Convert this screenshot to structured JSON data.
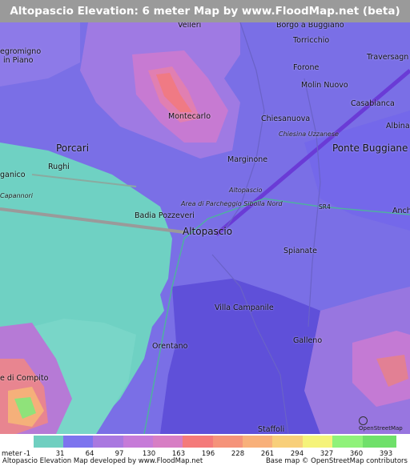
{
  "title": "Altopascio Elevation: 6 meter Map by www.FloodMap.net (beta)",
  "map": {
    "labels": {
      "vellori": "Velleri",
      "borgo": "Borgo a Buggiano",
      "torricchio": "Torricchio",
      "negromigno": "egromigno",
      "inpiano": "in Piano",
      "traversagna": "Traversagn",
      "forone": "Forone",
      "molin_nuovo": "Molin Nuovo",
      "montecarlo": "Montecarlo",
      "casabianca": "Casabianca",
      "chiesanuova": "Chiesanuova",
      "albinatico": "Albinat",
      "chiesina": "Chiesina Uzzanese",
      "porcari": "Porcari",
      "ponte_buggianese": "Ponte Buggiane",
      "rughi": "Rughi",
      "marginone": "Marginone",
      "ganico": "ganico",
      "altopascio_small": "Altopascio",
      "parcheggio": "Area di Parcheggio Sibolla Nord",
      "capannori": "Capannori",
      "sr4": "SR4",
      "anch": "Anch",
      "badia": "Badia Pozzeveri",
      "altopascio": "Altopascio",
      "spianate": "Spianate",
      "villa_campanile": "Villa Campanile",
      "orentano": "Orentano",
      "galleno": "Galleno",
      "compito": "e di Compito",
      "staffoli": "Staffoli",
      "osm_badge": "OpenStreetMap"
    }
  },
  "legend": {
    "unit": "meter",
    "ticks": [
      "-1",
      "31",
      "64",
      "97",
      "130",
      "163",
      "196",
      "228",
      "261",
      "294",
      "327",
      "360",
      "393"
    ],
    "colors": [
      "#6fcfc0",
      "#7d74ee",
      "#a978e0",
      "#c67bd8",
      "#d77ec4",
      "#f47a7a",
      "#f5937a",
      "#f8b07a",
      "#f8cf7a",
      "#f5f37a",
      "#8ff27a",
      "#6fe06a"
    ]
  },
  "footer": {
    "left": "Altopascio Elevation Map developed by www.FloodMap.net",
    "right": "Base map © OpenStreetMap contributors"
  }
}
